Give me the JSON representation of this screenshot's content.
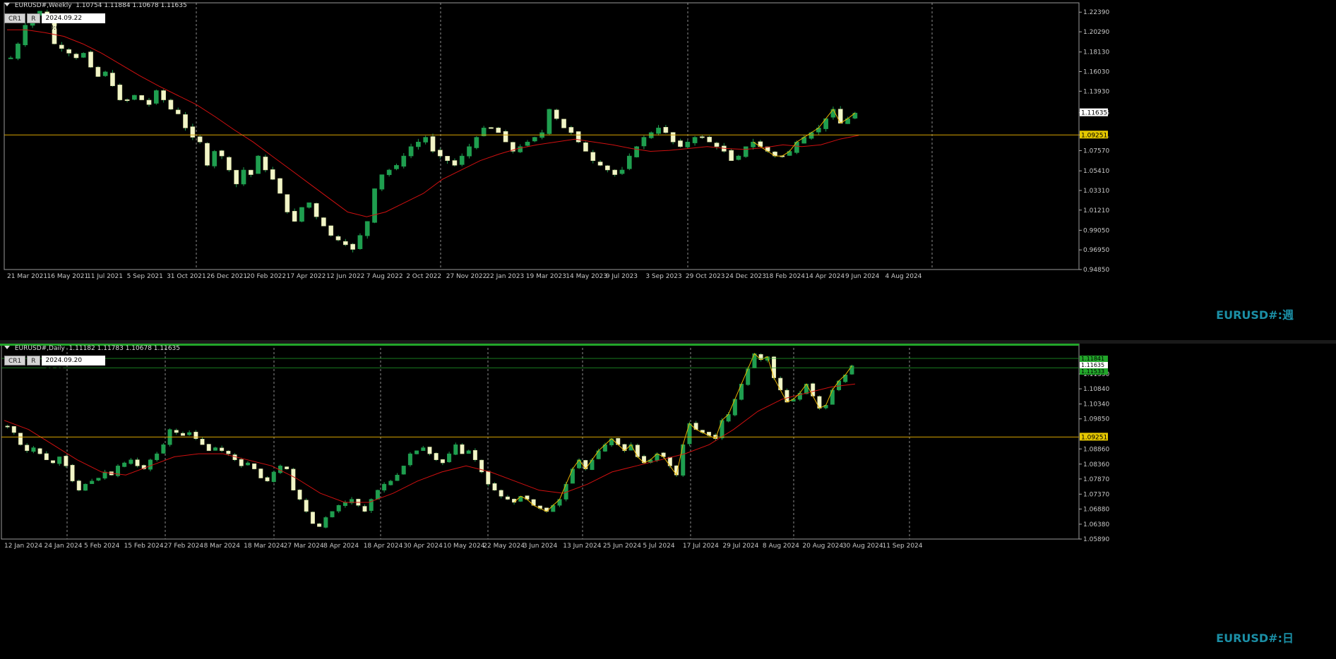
{
  "weekly": {
    "title": "EURUSD#,Weekly",
    "ohlc": "1.10754 1.11884 1.10678 1.11635",
    "btn_cr": "CR1",
    "btn_r": "R",
    "date": "2024.09.22 00:00",
    "watermark": "EURUSD#:週",
    "price_ticks": [
      "1.22390",
      "1.20290",
      "1.18130",
      "1.16030",
      "1.13930",
      "1.11635",
      "1.09251",
      "1.07570",
      "1.05410",
      "1.03310",
      "1.01210",
      "0.99050",
      "0.96950",
      "0.94850"
    ],
    "time_labels": [
      "21 Mar 2021",
      "16 May 2021",
      "11 Jul 2021",
      "5 Sep 2021",
      "31 Oct 2021",
      "26 Dec 2021",
      "20 Feb 2022",
      "17 Apr 2022",
      "12 Jun 2022",
      "7 Aug 2022",
      "2 Oct 2022",
      "27 Nov 2022",
      "22 Jan 2023",
      "19 Mar 2023",
      "14 May 2023",
      "9 Jul 2023",
      "3 Sep 2023",
      "29 Oct 2023",
      "24 Dec 2023",
      "18 Feb 2024",
      "14 Apr 2024",
      "9 Jun 2024",
      "4 Aug 2024"
    ],
    "current_price": "1.11635",
    "level_price": "1.09251"
  },
  "daily": {
    "title": "EURUSD#,Daily",
    "ohlc": "1.11182 1.11783 1.10678 1.11635",
    "btn_cr": "CR1",
    "btn_r": "R",
    "date": "2024.09.20 00:00",
    "watermark": "EURUSD#:日",
    "price_ticks": [
      "1.11330",
      "1.10840",
      "1.10340",
      "1.09850",
      "1.08860",
      "1.08360",
      "1.07870",
      "1.07370",
      "1.06880",
      "1.06380",
      "1.05890"
    ],
    "time_labels": [
      "12 Jan 2024",
      "24 Jan 2024",
      "5 Feb 2024",
      "15 Feb 2024",
      "27 Feb 2024",
      "8 Mar 2024",
      "18 Mar 2024",
      "27 Mar 2024",
      "8 Apr 2024",
      "18 Apr 2024",
      "30 Apr 2024",
      "10 May 2024",
      "22 May 2024",
      "3 Jun 2024",
      "13 Jun 2024",
      "25 Jun 2024",
      "5 Jul 2024",
      "17 Jul 2024",
      "29 Jul 2024",
      "8 Aug 2024",
      "20 Aug 2024",
      "30 Aug 2024",
      "11 Sep 2024"
    ],
    "upper_labels": [
      "1.11841",
      "1.11635",
      "1.11533"
    ],
    "level_price": "1.09251"
  },
  "colors": {
    "bull": "#1f9e4f",
    "bear": "#f2f5c8",
    "ma": "#d01010",
    "zigzag": "#e8b400",
    "level": "#d8a400",
    "grid": "#b0b0b0",
    "green_band": "#22a52a"
  },
  "chart_data": [
    {
      "type": "candlestick",
      "title": "EURUSD#,Weekly",
      "ylim": [
        0.9485,
        1.2339
      ],
      "x_labels": [
        "21 Mar 2021",
        "16 May 2021",
        "11 Jul 2021",
        "5 Sep 2021",
        "31 Oct 2021",
        "26 Dec 2021",
        "20 Feb 2022",
        "17 Apr 2022",
        "12 Jun 2022",
        "7 Aug 2022",
        "2 Oct 2022",
        "27 Nov 2022",
        "22 Jan 2023",
        "19 Mar 2023",
        "14 May 2023",
        "9 Jul 2023",
        "3 Sep 2023",
        "29 Oct 2023",
        "24 Dec 2023",
        "18 Feb 2024",
        "14 Apr 2024",
        "9 Jun 2024",
        "4 Aug 2024"
      ],
      "close_path": [
        1.175,
        1.19,
        1.21,
        1.22,
        1.225,
        1.215,
        1.19,
        1.185,
        1.18,
        1.175,
        1.18,
        1.165,
        1.155,
        1.16,
        1.145,
        1.13,
        1.13,
        1.135,
        1.13,
        1.125,
        1.14,
        1.13,
        1.12,
        1.115,
        1.1,
        1.09,
        1.085,
        1.06,
        1.075,
        1.07,
        1.055,
        1.04,
        1.055,
        1.05,
        1.07,
        1.055,
        1.045,
        1.03,
        1.01,
        1.0,
        1.015,
        1.02,
        1.005,
        0.995,
        0.985,
        0.98,
        0.975,
        0.97,
        0.985,
        1.0,
        1.035,
        1.05,
        1.055,
        1.06,
        1.07,
        1.08,
        1.085,
        1.09,
        1.075,
        1.07,
        1.065,
        1.06,
        1.07,
        1.08,
        1.09,
        1.1,
        1.1,
        1.095,
        1.085,
        1.075,
        1.08,
        1.085,
        1.09,
        1.095,
        1.12,
        1.11,
        1.1,
        1.095,
        1.085,
        1.075,
        1.065,
        1.06,
        1.055,
        1.05,
        1.055,
        1.07,
        1.08,
        1.09,
        1.095,
        1.1,
        1.095,
        1.085,
        1.08,
        1.085,
        1.09,
        1.09,
        1.085,
        1.08,
        1.075,
        1.065,
        1.07,
        1.08,
        1.085,
        1.08,
        1.075,
        1.07,
        1.07,
        1.075,
        1.085,
        1.09,
        1.095,
        1.1,
        1.11,
        1.12,
        1.105,
        1.11,
        1.116
      ],
      "ma_path": [
        1.205,
        1.205,
        1.202,
        1.198,
        1.19,
        1.18,
        1.168,
        1.156,
        1.145,
        1.135,
        1.125,
        1.112,
        1.098,
        1.085,
        1.07,
        1.055,
        1.04,
        1.025,
        1.01,
        1.005,
        1.01,
        1.02,
        1.03,
        1.045,
        1.055,
        1.065,
        1.072,
        1.078,
        1.082,
        1.085,
        1.088,
        1.085,
        1.082,
        1.078,
        1.075,
        1.076,
        1.078,
        1.08,
        1.078,
        1.077,
        1.079,
        1.082,
        1.08,
        1.082,
        1.088,
        1.092
      ],
      "level": 1.09251,
      "current": 1.11635
    },
    {
      "type": "candlestick",
      "title": "EURUSD#,Daily",
      "ylim": [
        1.0589,
        1.1233
      ],
      "x_labels": [
        "12 Jan 2024",
        "24 Jan 2024",
        "5 Feb 2024",
        "15 Feb 2024",
        "27 Feb 2024",
        "8 Mar 2024",
        "18 Mar 2024",
        "27 Mar 2024",
        "8 Apr 2024",
        "18 Apr 2024",
        "30 Apr 2024",
        "10 May 2024",
        "22 May 2024",
        "3 Jun 2024",
        "13 Jun 2024",
        "25 Jun 2024",
        "5 Jul 2024",
        "17 Jul 2024",
        "29 Jul 2024",
        "8 Aug 2024",
        "20 Aug 2024",
        "30 Aug 2024",
        "11 Sep 2024"
      ],
      "close_path": [
        1.096,
        1.094,
        1.09,
        1.088,
        1.089,
        1.087,
        1.085,
        1.084,
        1.086,
        1.083,
        1.078,
        1.075,
        1.077,
        1.078,
        1.079,
        1.081,
        1.08,
        1.083,
        1.084,
        1.085,
        1.083,
        1.082,
        1.085,
        1.087,
        1.09,
        1.095,
        1.094,
        1.093,
        1.094,
        1.092,
        1.09,
        1.088,
        1.089,
        1.088,
        1.087,
        1.085,
        1.083,
        1.084,
        1.082,
        1.079,
        1.078,
        1.081,
        1.083,
        1.082,
        1.075,
        1.072,
        1.068,
        1.064,
        1.063,
        1.066,
        1.068,
        1.07,
        1.071,
        1.072,
        1.07,
        1.068,
        1.072,
        1.075,
        1.077,
        1.078,
        1.08,
        1.083,
        1.087,
        1.088,
        1.089,
        1.087,
        1.085,
        1.084,
        1.087,
        1.09,
        1.087,
        1.088,
        1.085,
        1.081,
        1.077,
        1.075,
        1.073,
        1.072,
        1.071,
        1.073,
        1.072,
        1.07,
        1.069,
        1.068,
        1.07,
        1.072,
        1.077,
        1.082,
        1.085,
        1.082,
        1.085,
        1.088,
        1.09,
        1.092,
        1.09,
        1.088,
        1.09,
        1.086,
        1.084,
        1.085,
        1.087,
        1.086,
        1.083,
        1.08,
        1.09,
        1.097,
        1.095,
        1.094,
        1.093,
        1.092,
        1.098,
        1.1,
        1.105,
        1.11,
        1.115,
        1.12,
        1.118,
        1.119,
        1.112,
        1.108,
        1.104,
        1.105,
        1.107,
        1.11,
        1.106,
        1.102,
        1.103,
        1.108,
        1.111,
        1.113,
        1.116
      ],
      "ma_path": [
        1.098,
        1.095,
        1.09,
        1.085,
        1.081,
        1.08,
        1.083,
        1.086,
        1.087,
        1.087,
        1.085,
        1.083,
        1.079,
        1.074,
        1.071,
        1.071,
        1.074,
        1.078,
        1.081,
        1.083,
        1.081,
        1.078,
        1.075,
        1.074,
        1.077,
        1.081,
        1.083,
        1.085,
        1.087,
        1.09,
        1.095,
        1.101,
        1.105,
        1.107,
        1.109,
        1.11
      ],
      "level": 1.09251,
      "upper_levels": [
        1.11841,
        1.11533
      ]
    }
  ]
}
